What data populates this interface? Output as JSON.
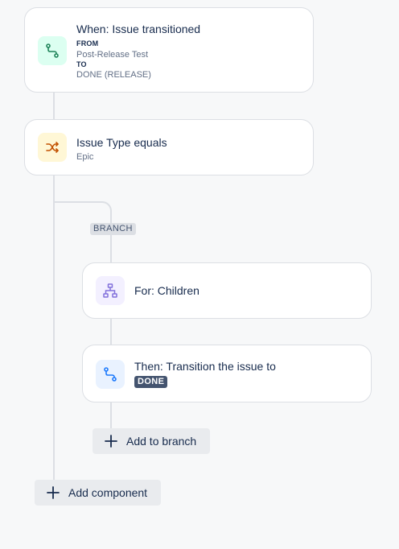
{
  "trigger": {
    "title": "When: Issue transitioned",
    "from_label": "FROM",
    "from_value": "Post-Release Test",
    "to_label": "TO",
    "to_value": "DONE (RELEASE)",
    "icon": "transition-icon",
    "icon_bg": "#dcfff1",
    "icon_color": "#1f845a"
  },
  "condition": {
    "title": "Issue Type equals",
    "value": "Epic",
    "icon": "shuffle-icon",
    "icon_bg": "#fff7d6",
    "icon_color": "#c25100"
  },
  "branch_label": "BRANCH",
  "branch_card": {
    "title": "For: Children",
    "icon": "hierarchy-icon",
    "icon_bg": "#f3f0ff",
    "icon_color": "#8270db"
  },
  "action_card": {
    "title": "Then: Transition the issue to",
    "status": "DONE",
    "status_bg": "#44546f",
    "status_color": "#ffffff",
    "icon": "transition-icon",
    "icon_bg": "#e9f2ff",
    "icon_color": "#1d7afc"
  },
  "add_to_branch_label": "Add to branch",
  "add_component_label": "Add component"
}
